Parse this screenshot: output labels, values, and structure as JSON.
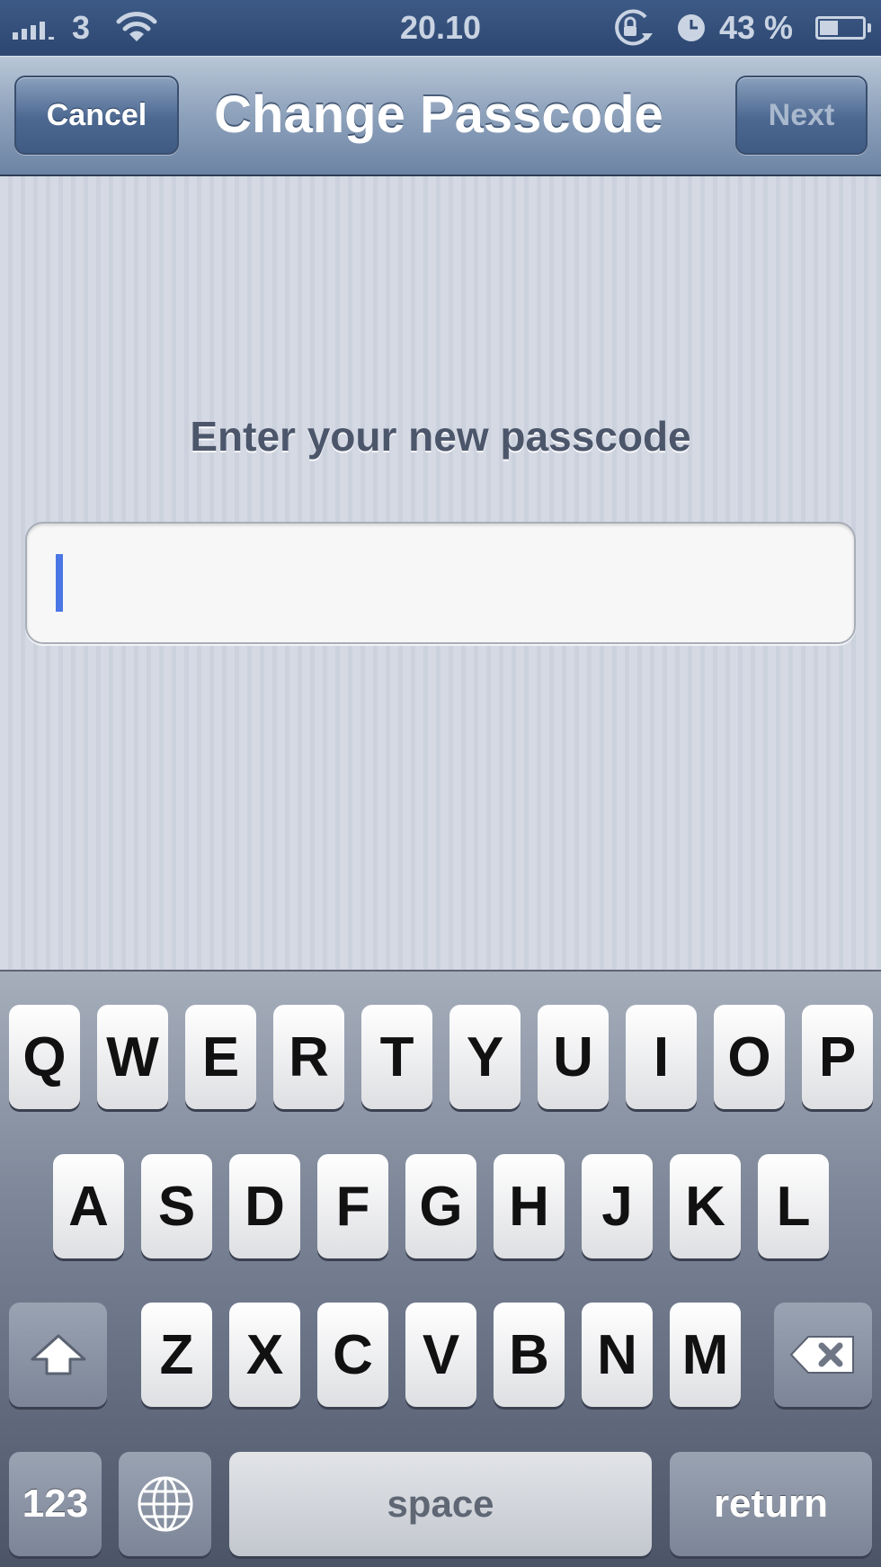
{
  "status_bar": {
    "carrier": "3",
    "time": "20.10",
    "battery_percent": "43 %",
    "battery_level": 0.43,
    "icons": [
      "signal-bars-icon",
      "wifi-icon",
      "rotation-lock-icon",
      "alarm-clock-icon",
      "battery-icon"
    ]
  },
  "nav": {
    "title": "Change Passcode",
    "cancel_label": "Cancel",
    "next_label": "Next"
  },
  "content": {
    "prompt": "Enter your new passcode",
    "passcode_value": ""
  },
  "keyboard": {
    "row1": [
      "Q",
      "W",
      "E",
      "R",
      "T",
      "Y",
      "U",
      "I",
      "O",
      "P"
    ],
    "row2": [
      "A",
      "S",
      "D",
      "F",
      "G",
      "H",
      "J",
      "K",
      "L"
    ],
    "row3": [
      "Z",
      "X",
      "C",
      "V",
      "B",
      "N",
      "M"
    ],
    "numbers_label": "123",
    "space_label": "space",
    "return_label": "return",
    "icons": [
      "shift-icon",
      "backspace-icon",
      "globe-icon"
    ]
  }
}
